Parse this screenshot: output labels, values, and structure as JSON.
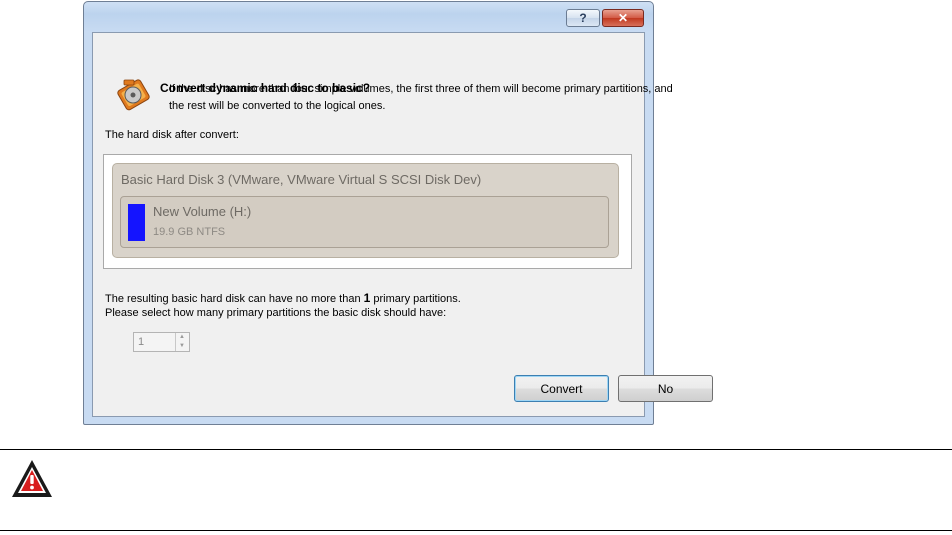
{
  "dialog": {
    "help_label": "?",
    "close_label": "✕",
    "title": "Convert dynamic hard disc to basic?",
    "description": "If the disc has more than four simple volumes, the first three of them will become primary partitions, and the rest will be converted to the logical ones.",
    "after_convert_label": "The hard disk after convert:",
    "disk": {
      "name": "Basic Hard Disk 3 (VMware, VMware Virtual S SCSI Disk Dev)",
      "volume": {
        "name": "New Volume (H:)",
        "size": "19.9 GB NTFS",
        "color": "#1414ff"
      }
    },
    "limit_text_prefix": "The resulting basic hard disk can have no more than",
    "limit_value": "1",
    "limit_text_suffix": "primary partitions.",
    "select_text": "Please select how many primary partitions the basic disk should have:",
    "spin_value": "1",
    "convert_label": "Convert",
    "no_label": "No"
  },
  "icons": {
    "disk": "disk-convert-icon",
    "warning": "warning-icon"
  }
}
